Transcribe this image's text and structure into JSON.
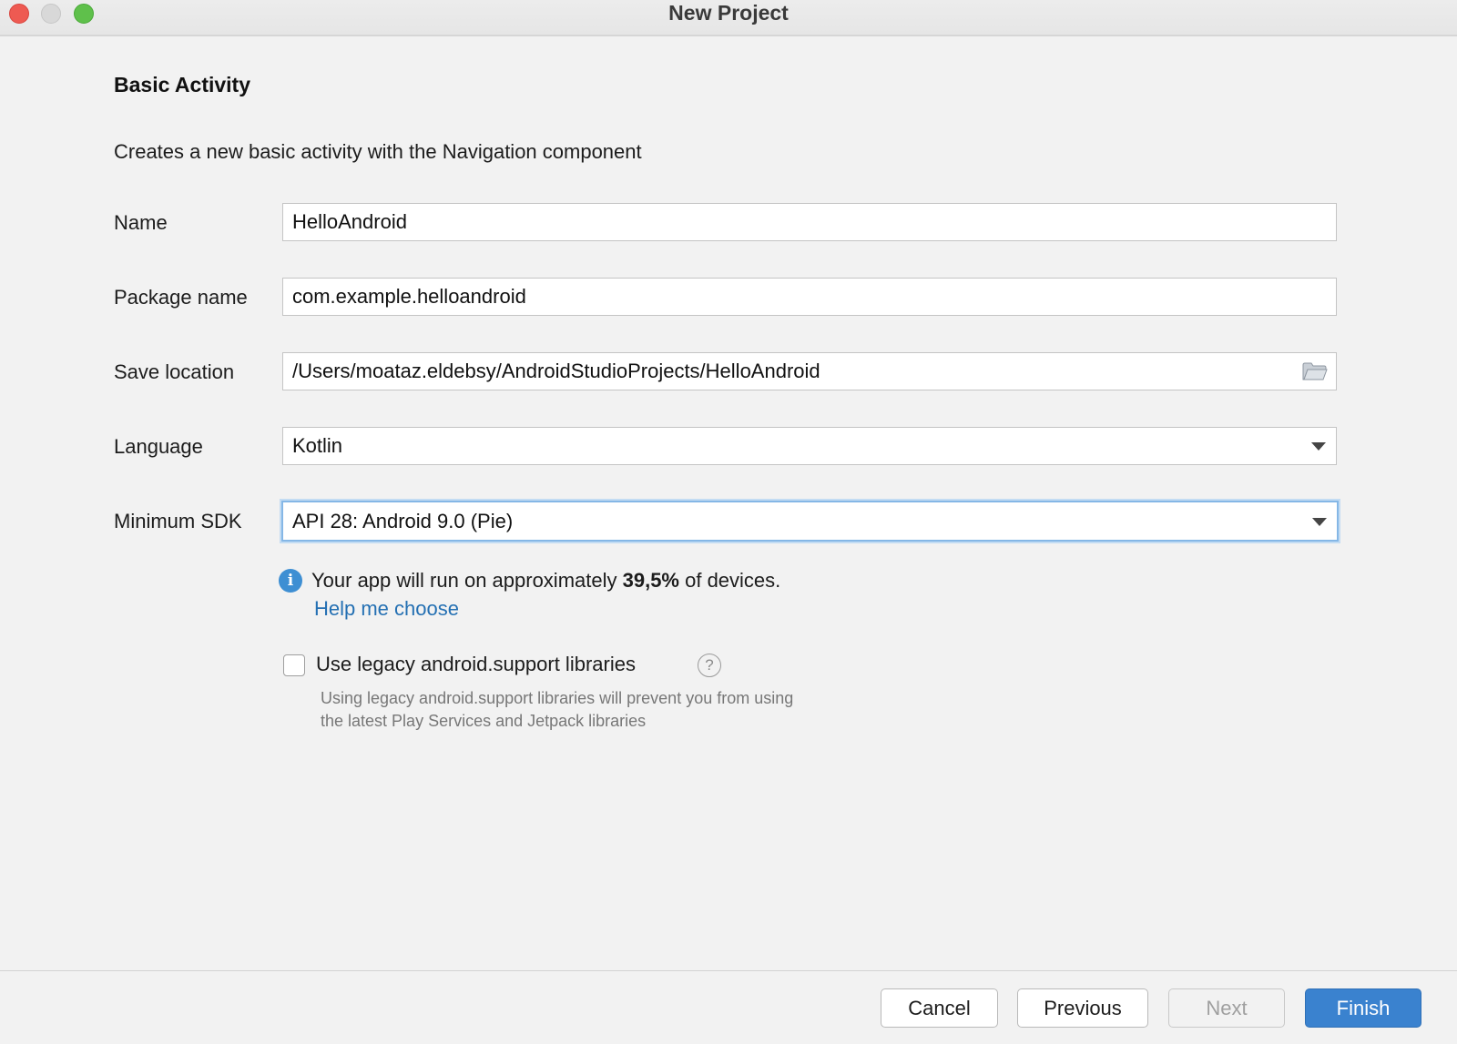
{
  "window": {
    "title": "New Project"
  },
  "header": {
    "title": "Basic Activity",
    "description": "Creates a new basic activity with the Navigation component"
  },
  "form": {
    "name": {
      "label": "Name",
      "value": "HelloAndroid"
    },
    "package": {
      "label": "Package name",
      "value": "com.example.helloandroid"
    },
    "save_location": {
      "label": "Save location",
      "value": "/Users/moataz.eldebsy/AndroidStudioProjects/HelloAndroid",
      "icon": "folder-icon"
    },
    "language": {
      "label": "Language",
      "value": "Kotlin"
    },
    "min_sdk": {
      "label": "Minimum SDK",
      "value": "API 28: Android 9.0 (Pie)"
    }
  },
  "info": {
    "prefix": "Your app will run on approximately ",
    "percent": "39,5%",
    "suffix": " of devices.",
    "help_link": "Help me choose"
  },
  "legacy": {
    "label": "Use legacy android.support libraries",
    "checked": false,
    "note_line1": "Using legacy android.support libraries will prevent you from using",
    "note_line2": "the latest Play Services and Jetpack libraries"
  },
  "buttons": {
    "cancel": "Cancel",
    "previous": "Previous",
    "next": "Next",
    "finish": "Finish"
  },
  "colors": {
    "accent": "#3a82cf",
    "link": "#2470b3",
    "focus_ring": "#85b7e6"
  }
}
